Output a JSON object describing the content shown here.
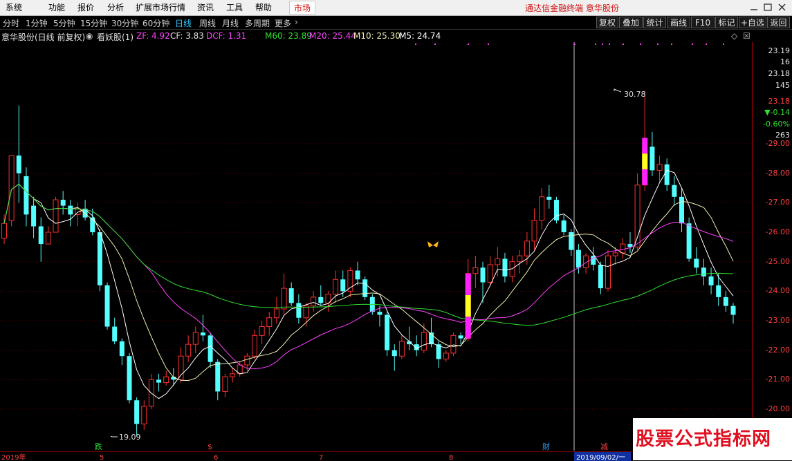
{
  "menubar": {
    "items": [
      "系统",
      "功能",
      "报价",
      "分析",
      "扩展市场行情",
      "资讯",
      "工具",
      "帮助"
    ],
    "market_tab": "市场",
    "app_title": "通达信金融终端  意华股份"
  },
  "period_tabs": [
    "分时",
    "1分钟",
    "5分钟",
    "15分钟",
    "30分钟",
    "60分钟",
    "日线",
    "周线",
    "月线",
    "多周期",
    "更多"
  ],
  "active_period": "日线",
  "toolbar_buttons": [
    "复权",
    "叠加",
    "统计",
    "画线",
    "F10",
    "标记",
    "+自选",
    "返回"
  ],
  "info": {
    "stock_label": "意华股份(日线 前复权)",
    "indicator": "看妖股(1)",
    "zf": "ZF: 4.92",
    "cf": "CF: 3.83",
    "dcf": "DCF: 1.31",
    "m60": "M60: 23.89",
    "m20": "M20: 25.44",
    "m10": "M10: 25.30",
    "m5": "M5: 24.74"
  },
  "chart_data": {
    "type": "candlestick",
    "y_ticks": [
      "29.00",
      "28.00",
      "27.00",
      "26.00",
      "25.00",
      "24.00",
      "23.00",
      "22.00",
      "21.00",
      "20.00"
    ],
    "ylim": [
      19.8,
      30.5
    ],
    "right_panel": {
      "high": "23.19",
      "val2": "16",
      "price": "23.18",
      "val4": "145",
      "last": "23.18",
      "change": "▼-0.14",
      "change_pct": "-0.60%",
      "val8": "263"
    },
    "annotation_high": "30.78",
    "annotation_low": "19.09",
    "x_labels": [
      "2019年",
      "5",
      "6",
      "7",
      "8"
    ],
    "date_box": "2019/09/02/一",
    "bottom_markers": [
      "跌",
      "$",
      "财",
      "减"
    ],
    "colors": {
      "up": "#ff3030",
      "down": "#54ffff",
      "m5": "#ffffff",
      "m10": "#f0f0b0",
      "m20": "#ff40ff",
      "m60": "#30e030",
      "signal_magenta": "#ff20ff",
      "signal_yellow": "#ffff20"
    },
    "candles": [
      [
        25.8,
        26.6,
        25.6,
        26.3
      ],
      [
        26.4,
        28.0,
        26.2,
        28.6
      ],
      [
        28.6,
        30.3,
        27.0,
        28.0
      ],
      [
        27.9,
        28.2,
        26.2,
        26.6
      ],
      [
        26.9,
        27.2,
        25.8,
        26.2
      ],
      [
        26.2,
        26.5,
        25.0,
        25.6
      ],
      [
        25.6,
        26.2,
        25.6,
        26.0
      ],
      [
        26.0,
        27.2,
        26.0,
        27.1
      ],
      [
        27.1,
        27.4,
        26.6,
        26.9
      ],
      [
        26.9,
        27.1,
        26.2,
        26.6
      ],
      [
        26.6,
        27.0,
        26.2,
        26.8
      ],
      [
        26.8,
        27.1,
        26.4,
        26.5
      ],
      [
        26.5,
        26.8,
        25.9,
        26.0
      ],
      [
        26.0,
        26.1,
        24.0,
        24.2
      ],
      [
        24.2,
        24.3,
        22.7,
        22.8
      ],
      [
        22.8,
        23.1,
        22.2,
        22.3
      ],
      [
        22.3,
        22.4,
        21.5,
        21.8
      ],
      [
        21.8,
        21.9,
        20.2,
        20.3
      ],
      [
        20.3,
        20.4,
        19.1,
        19.5
      ],
      [
        19.5,
        20.3,
        19.3,
        20.1
      ],
      [
        20.1,
        21.2,
        20.0,
        21.0
      ],
      [
        21.0,
        21.2,
        20.6,
        20.9
      ],
      [
        20.9,
        21.3,
        20.8,
        21.1
      ],
      [
        21.1,
        21.4,
        20.8,
        21.0
      ],
      [
        21.0,
        22.1,
        20.9,
        21.8
      ],
      [
        21.8,
        22.5,
        21.6,
        22.2
      ],
      [
        22.2,
        22.8,
        21.9,
        22.6
      ],
      [
        22.6,
        23.2,
        22.3,
        22.5
      ],
      [
        22.5,
        22.6,
        21.4,
        21.6
      ],
      [
        21.6,
        21.7,
        20.3,
        20.6
      ],
      [
        20.6,
        21.2,
        20.4,
        21.1
      ],
      [
        21.1,
        21.4,
        20.9,
        21.2
      ],
      [
        21.2,
        21.6,
        21.1,
        21.5
      ],
      [
        21.5,
        21.9,
        21.3,
        21.8
      ],
      [
        21.8,
        22.7,
        21.7,
        22.5
      ],
      [
        22.5,
        23.0,
        22.2,
        22.8
      ],
      [
        22.8,
        23.3,
        22.5,
        23.1
      ],
      [
        23.1,
        23.8,
        22.9,
        23.4
      ],
      [
        23.4,
        24.6,
        23.2,
        24.1
      ],
      [
        24.1,
        24.3,
        23.5,
        23.6
      ],
      [
        23.6,
        23.9,
        22.9,
        23.1
      ],
      [
        23.1,
        23.6,
        22.8,
        23.5
      ],
      [
        23.5,
        24.0,
        23.3,
        23.8
      ],
      [
        23.8,
        24.2,
        23.5,
        23.6
      ],
      [
        23.6,
        24.0,
        23.3,
        23.9
      ],
      [
        23.9,
        24.7,
        23.6,
        24.4
      ],
      [
        24.4,
        24.7,
        23.8,
        24.0
      ],
      [
        24.0,
        24.8,
        23.8,
        24.7
      ],
      [
        24.7,
        25.0,
        24.2,
        24.4
      ],
      [
        24.4,
        24.5,
        23.7,
        23.8
      ],
      [
        23.8,
        23.9,
        23.2,
        23.3
      ],
      [
        23.3,
        23.5,
        22.8,
        23.2
      ],
      [
        23.2,
        23.3,
        21.8,
        22.0
      ],
      [
        22.0,
        22.2,
        21.3,
        21.8
      ],
      [
        21.8,
        22.5,
        21.7,
        22.3
      ],
      [
        22.3,
        22.8,
        22.0,
        22.2
      ],
      [
        22.2,
        22.5,
        21.8,
        22.0
      ],
      [
        22.0,
        22.9,
        21.9,
        22.6
      ],
      [
        22.6,
        23.1,
        22.1,
        22.2
      ],
      [
        22.2,
        22.3,
        21.4,
        21.7
      ],
      [
        21.7,
        22.0,
        21.6,
        21.9
      ],
      [
        21.9,
        22.6,
        21.8,
        22.5
      ],
      [
        22.5,
        22.6,
        22.2,
        22.4
      ],
      [
        22.4,
        25.1,
        22.3,
        24.6
      ],
      [
        24.6,
        25.2,
        24.1,
        24.8
      ],
      [
        24.8,
        25.0,
        23.6,
        24.3
      ],
      [
        24.3,
        25.2,
        24.2,
        24.9
      ],
      [
        24.9,
        25.5,
        24.5,
        25.1
      ],
      [
        25.1,
        25.3,
        24.3,
        24.5
      ],
      [
        24.5,
        25.2,
        24.3,
        25.0
      ],
      [
        25.0,
        25.4,
        24.6,
        25.2
      ],
      [
        25.2,
        26.0,
        24.9,
        25.7
      ],
      [
        25.7,
        26.8,
        25.4,
        26.4
      ],
      [
        26.4,
        27.5,
        26.1,
        27.2
      ],
      [
        27.2,
        27.6,
        26.8,
        27.1
      ],
      [
        27.1,
        27.2,
        26.3,
        26.4
      ],
      [
        26.4,
        26.6,
        25.9,
        26.0
      ],
      [
        26.0,
        26.1,
        25.2,
        25.4
      ],
      [
        25.4,
        25.6,
        24.6,
        24.8
      ],
      [
        24.8,
        25.3,
        24.6,
        25.2
      ],
      [
        25.2,
        25.5,
        24.7,
        24.9
      ],
      [
        24.9,
        25.0,
        23.9,
        24.1
      ],
      [
        24.1,
        25.4,
        24.0,
        25.2
      ],
      [
        25.2,
        25.5,
        24.9,
        25.3
      ],
      [
        25.3,
        25.8,
        25.1,
        25.6
      ],
      [
        25.6,
        26.0,
        25.3,
        25.5
      ],
      [
        25.5,
        28.0,
        25.4,
        27.6
      ],
      [
        27.6,
        30.8,
        27.4,
        28.9
      ],
      [
        28.9,
        29.4,
        27.9,
        28.1
      ],
      [
        28.1,
        28.6,
        27.7,
        28.3
      ],
      [
        28.3,
        28.5,
        27.4,
        27.6
      ],
      [
        27.6,
        27.9,
        26.9,
        27.2
      ],
      [
        27.2,
        27.5,
        26.0,
        26.3
      ],
      [
        26.3,
        26.5,
        25.0,
        25.1
      ],
      [
        25.1,
        25.5,
        24.6,
        24.8
      ],
      [
        24.8,
        25.1,
        24.2,
        24.5
      ],
      [
        24.5,
        24.8,
        23.9,
        24.2
      ],
      [
        24.2,
        24.6,
        23.5,
        23.8
      ],
      [
        23.8,
        24.0,
        23.3,
        23.5
      ],
      [
        23.5,
        23.6,
        22.9,
        23.2
      ]
    ]
  }
}
